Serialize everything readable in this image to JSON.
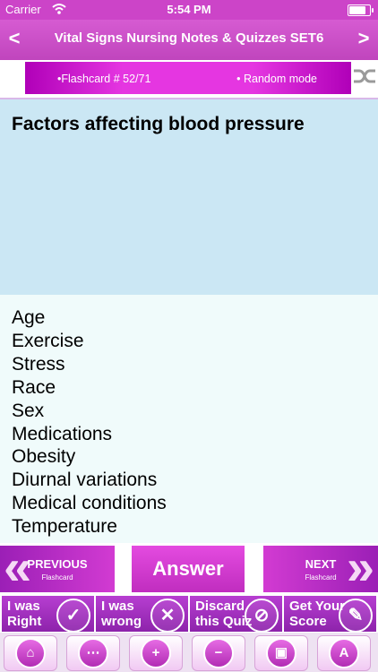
{
  "status": {
    "carrier": "Carrier",
    "time": "5:54 PM",
    "battery_level": 0.9
  },
  "nav": {
    "title": "Vital Signs Nursing Notes & Quizzes SET6",
    "back_symbol": "<",
    "forward_symbol": ">"
  },
  "banner": {
    "flashcard_label": "•Flashcard #  52/71",
    "mode_label": "• Random mode"
  },
  "question": "Factors affecting blood pressure",
  "answer_items": [
    "Age",
    "Exercise",
    "Stress",
    "Race",
    "Sex",
    "Medications",
    "Obesity",
    "Diurnal variations",
    "Medical conditions",
    "Temperature"
  ],
  "controls": {
    "previous": {
      "label": "PREVIOUS",
      "sub": "Flashcard"
    },
    "answer": "Answer",
    "next": {
      "label": "NEXT",
      "sub": "Flashcard"
    }
  },
  "actions": [
    {
      "line1": "I was",
      "line2": "Right",
      "icon": "check-icon"
    },
    {
      "line1": "I was",
      "line2": "wrong",
      "icon": "x-icon"
    },
    {
      "line1": "Discard",
      "line2": "this Quiz",
      "icon": "prohibit-icon"
    },
    {
      "line1": "Get Your",
      "line2": "Score",
      "icon": "score-icon"
    }
  ],
  "toolbar": [
    "home-icon",
    "share-icon",
    "zoom-in-icon",
    "zoom-out-icon",
    "slideshow-icon",
    "font-icon"
  ],
  "colors": {
    "accent": "#cc44c8",
    "question_bg": "#cbe7f4",
    "answer_bg": "#f0fbfb"
  }
}
